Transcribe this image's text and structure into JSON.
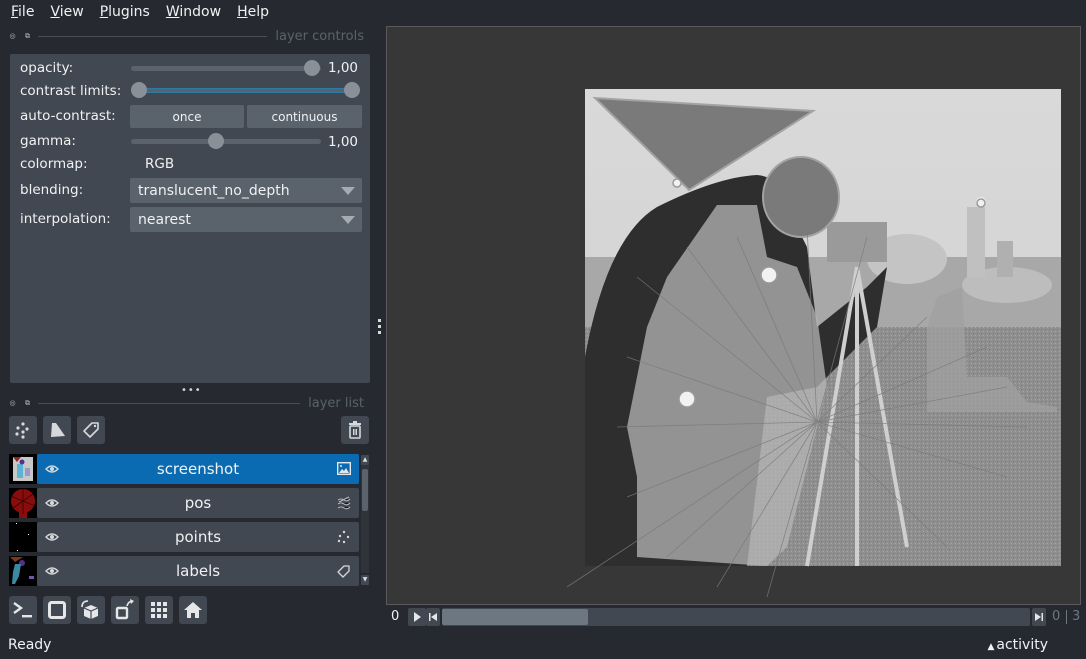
{
  "menu": [
    {
      "label": "File",
      "mnemonic": "F",
      "rest": "ile"
    },
    {
      "label": "View",
      "mnemonic": "V",
      "rest": "iew"
    },
    {
      "label": "Plugins",
      "mnemonic": "P",
      "rest": "lugins"
    },
    {
      "label": "Window",
      "mnemonic": "W",
      "rest": "indow"
    },
    {
      "label": "Help",
      "mnemonic": "H",
      "rest": "elp"
    }
  ],
  "layer_controls": {
    "title": "layer controls",
    "opacity": {
      "label": "opacity:",
      "value": 1.0,
      "display": "1,00"
    },
    "contrast_limits": {
      "label": "contrast limits:",
      "low": 0.0,
      "high": 1.0
    },
    "auto_contrast": {
      "label": "auto-contrast:",
      "once": "once",
      "continuous": "continuous"
    },
    "gamma": {
      "label": "gamma:",
      "value": 1.0,
      "display": "1,00",
      "fraction": 0.4
    },
    "colormap": {
      "label": "colormap:",
      "value": "RGB"
    },
    "blending": {
      "label": "blending:",
      "value": "translucent_no_depth"
    },
    "interpolation": {
      "label": "interpolation:",
      "value": "nearest"
    }
  },
  "layer_list": {
    "title": "layer list",
    "new_points_icon": "points-icon",
    "new_shapes_icon": "shapes-icon",
    "new_labels_icon": "labels-tag-icon",
    "delete_icon": "trash-icon",
    "layers": [
      {
        "name": "screenshot",
        "type": "image",
        "selected": true,
        "visible": true
      },
      {
        "name": "pos",
        "type": "vectors",
        "selected": false,
        "visible": true
      },
      {
        "name": "points",
        "type": "points",
        "selected": false,
        "visible": true
      },
      {
        "name": "labels",
        "type": "labels",
        "selected": false,
        "visible": true
      }
    ]
  },
  "viewer_buttons": [
    "console",
    "ndisplay-2d",
    "roll-dims",
    "transpose-dims",
    "grid-view",
    "home"
  ],
  "dims": {
    "current": "0",
    "current_right": "0",
    "max": "3",
    "fraction": 0.0
  },
  "status": {
    "text": "Ready",
    "activity": "activity"
  },
  "colors": {
    "accent": "#0a6bb3",
    "panel": "#414851",
    "bg": "#262930",
    "canvas": "#373737"
  }
}
